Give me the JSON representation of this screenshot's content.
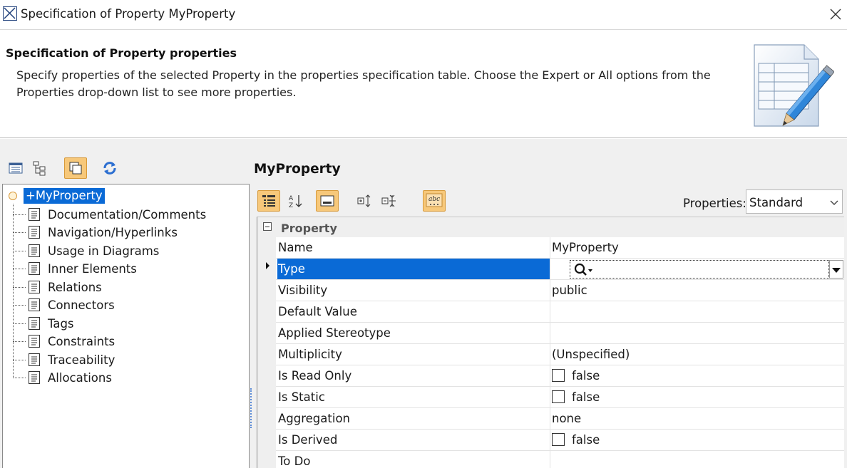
{
  "window": {
    "title": "Specification of Property MyProperty",
    "close_icon": "close-icon"
  },
  "header": {
    "title": "Specification of Property properties",
    "description": "Specify properties of the selected Property in the properties specification table. Choose the Expert or All options from the Properties drop-down list to see more properties."
  },
  "tree": {
    "root": "+MyProperty",
    "items": [
      {
        "label": "Documentation/Comments"
      },
      {
        "label": "Navigation/Hyperlinks"
      },
      {
        "label": "Usage in Diagrams"
      },
      {
        "label": "Inner Elements"
      },
      {
        "label": "Relations"
      },
      {
        "label": "Connectors"
      },
      {
        "label": "Tags"
      },
      {
        "label": "Constraints"
      },
      {
        "label": "Traceability"
      },
      {
        "label": "Allocations"
      }
    ]
  },
  "element": {
    "title": "MyProperty"
  },
  "properties_filter": {
    "label": "Properties:",
    "selected": "Standard"
  },
  "grid": {
    "group": "Property",
    "rows": [
      {
        "name": "Name",
        "value": "MyProperty",
        "kind": "text"
      },
      {
        "name": "Type",
        "value": "",
        "kind": "type",
        "selected": true
      },
      {
        "name": "Visibility",
        "value": "public",
        "kind": "text"
      },
      {
        "name": "Default Value",
        "value": "",
        "kind": "text"
      },
      {
        "name": "Applied Stereotype",
        "value": "",
        "kind": "text"
      },
      {
        "name": "Multiplicity",
        "value": "(Unspecified)",
        "kind": "text"
      },
      {
        "name": "Is Read Only",
        "value": "false",
        "kind": "check"
      },
      {
        "name": "Is Static",
        "value": "false",
        "kind": "check"
      },
      {
        "name": "Aggregation",
        "value": "none",
        "kind": "text"
      },
      {
        "name": "Is Derived",
        "value": "false",
        "kind": "check"
      },
      {
        "name": "To Do",
        "value": "",
        "kind": "text"
      }
    ]
  },
  "colors": {
    "selection": "#0a6ad6",
    "active_button": "#f7c87a"
  }
}
